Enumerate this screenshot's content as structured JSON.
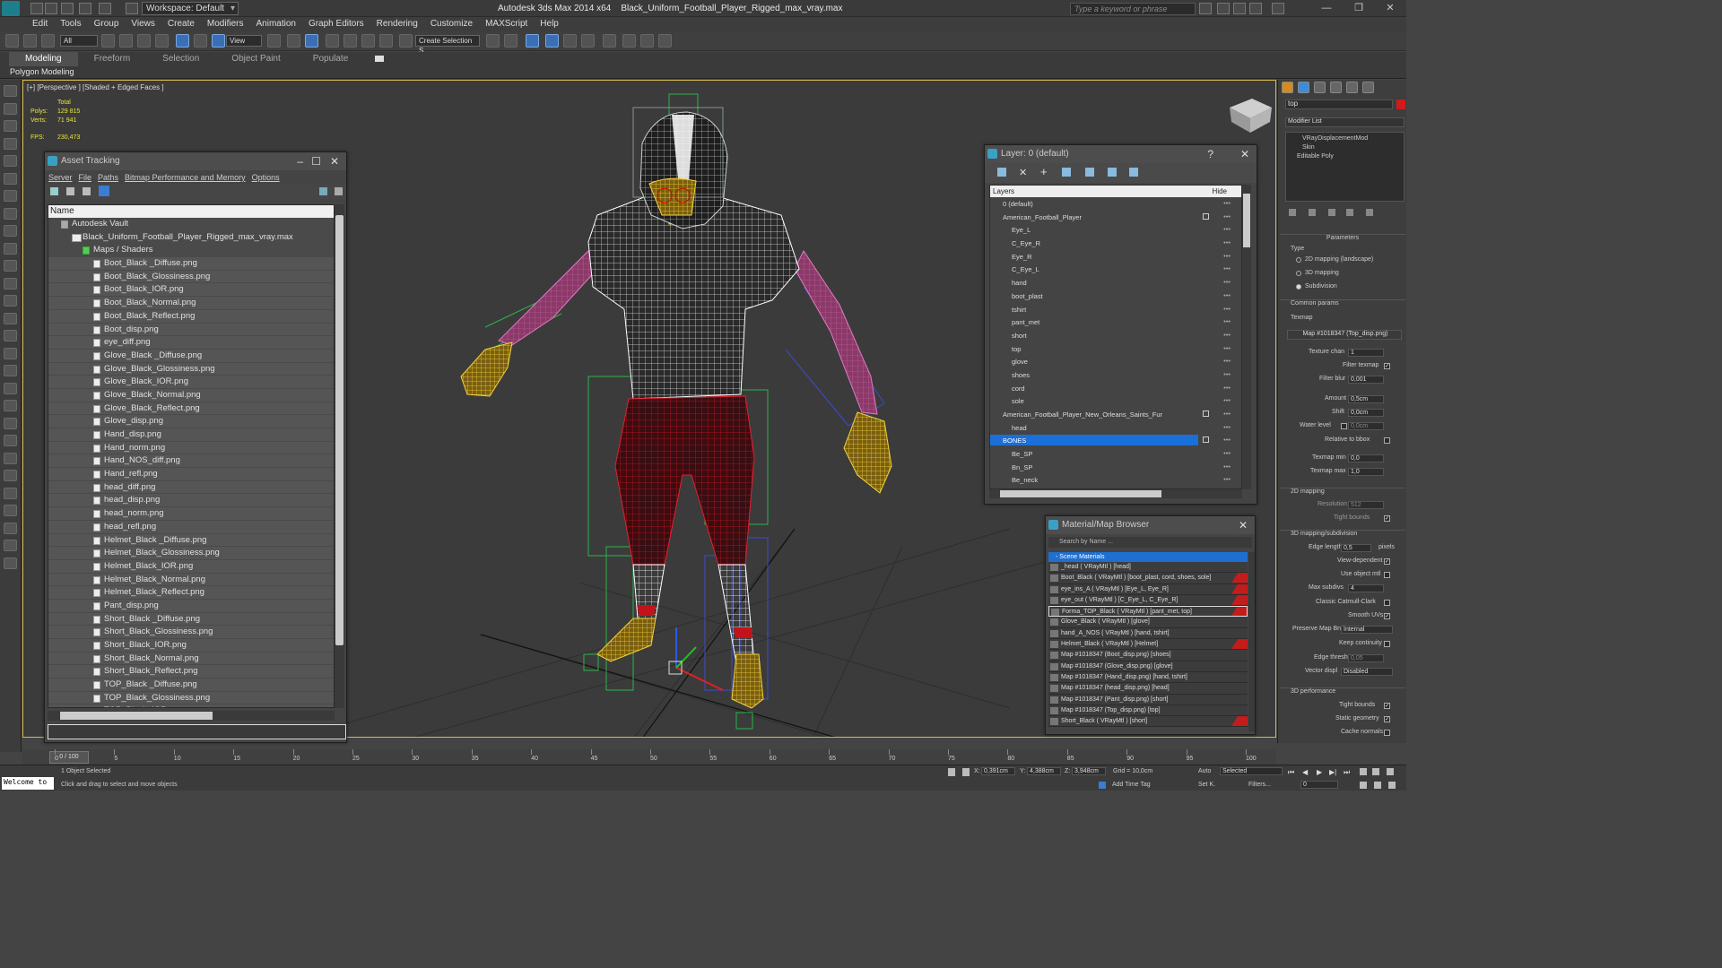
{
  "title_bar": {
    "app_title": "Autodesk 3ds Max  2014 x64",
    "file_name": "Black_Uniform_Football_Player_Rigged_max_vray.max",
    "workspace": "Workspace: Default",
    "search_placeholder": "Type a keyword or phrase"
  },
  "menu": [
    "Edit",
    "Tools",
    "Group",
    "Views",
    "Create",
    "Modifiers",
    "Animation",
    "Graph Editors",
    "Rendering",
    "Customize",
    "MAXScript",
    "Help"
  ],
  "toolbar": {
    "selection_filter": "All",
    "ref_coord": "View",
    "named_selection": "Create Selection S"
  },
  "ribbon": {
    "tabs": [
      "Modeling",
      "Freeform",
      "Selection",
      "Object Paint",
      "Populate"
    ],
    "active_tab": "Modeling",
    "sub_label": "Polygon Modeling"
  },
  "viewport": {
    "label": "[+] [Perspective ] [Shaded + Edged Faces ]",
    "stats_header": "Total",
    "polys_label": "Polys:",
    "polys_value": "129 815",
    "verts_label": "Verts:",
    "verts_value": "71 941",
    "fps_label": "FPS:",
    "fps_value": "230,473"
  },
  "asset_tracking": {
    "title": "Asset Tracking",
    "menu": [
      "Server",
      "File",
      "Paths",
      "Bitmap Performance and Memory",
      "Options"
    ],
    "column_header": "Name",
    "vault": "Autodesk Vault",
    "max_file": "Black_Uniform_Football_Player_Rigged_max_vray.max",
    "group": "Maps / Shaders",
    "files": [
      "Boot_Black _Diffuse.png",
      "Boot_Black_Glossiness.png",
      "Boot_Black_IOR.png",
      "Boot_Black_Normal.png",
      "Boot_Black_Reflect.png",
      "Boot_disp.png",
      "eye_diff.png",
      "Glove_Black _Diffuse.png",
      "Glove_Black_Glossiness.png",
      "Glove_Black_IOR.png",
      "Glove_Black_Normal.png",
      "Glove_Black_Reflect.png",
      "Glove_disp.png",
      "Hand_disp.png",
      "Hand_norm.png",
      "Hand_NOS_diff.png",
      "Hand_refl.png",
      "head_diff.png",
      "head_disp.png",
      "head_norm.png",
      "head_refl.png",
      "Helmet_Black _Diffuse.png",
      "Helmet_Black_Glossiness.png",
      "Helmet_Black_IOR.png",
      "Helmet_Black_Normal.png",
      "Helmet_Black_Reflect.png",
      "Pant_disp.png",
      "Short_Black _Diffuse.png",
      "Short_Black_Glossiness.png",
      "Short_Black_IOR.png",
      "Short_Black_Normal.png",
      "Short_Black_Reflect.png",
      "TOP_Black _Diffuse.png",
      "TOP_Black_Glossiness.png",
      "TOP_Black_IOR"
    ]
  },
  "layer_panel": {
    "title": "Layer: 0 (default)",
    "col_layers": "Layers",
    "col_hide": "Hide",
    "rows": [
      {
        "label": "0 (default)",
        "indent": 1,
        "check": false
      },
      {
        "label": "American_Football_Player",
        "indent": 1,
        "check": true
      },
      {
        "label": "Eye_L",
        "indent": 2,
        "check": false
      },
      {
        "label": "C_Eye_R",
        "indent": 2,
        "check": false
      },
      {
        "label": "Eye_R",
        "indent": 2,
        "check": false
      },
      {
        "label": "C_Eye_L",
        "indent": 2,
        "check": false
      },
      {
        "label": "hand",
        "indent": 2,
        "check": false
      },
      {
        "label": "boot_plast",
        "indent": 2,
        "check": false
      },
      {
        "label": "tshirt",
        "indent": 2,
        "check": false
      },
      {
        "label": "pant_met",
        "indent": 2,
        "check": false
      },
      {
        "label": "short",
        "indent": 2,
        "check": false
      },
      {
        "label": "top",
        "indent": 2,
        "check": false
      },
      {
        "label": "glove",
        "indent": 2,
        "check": false
      },
      {
        "label": "shoes",
        "indent": 2,
        "check": false
      },
      {
        "label": "cord",
        "indent": 2,
        "check": false
      },
      {
        "label": "sole",
        "indent": 2,
        "check": false
      },
      {
        "label": "American_Football_Player_New_Orleans_Saints_Fur",
        "indent": 1,
        "check": true
      },
      {
        "label": "head",
        "indent": 2,
        "check": false
      },
      {
        "label": "BONES",
        "indent": 1,
        "check": true,
        "selected": true
      },
      {
        "label": "Be_SP",
        "indent": 2,
        "check": false
      },
      {
        "label": "Bn_SP",
        "indent": 2,
        "check": false
      },
      {
        "label": "Be_neck",
        "indent": 2,
        "check": false
      }
    ]
  },
  "material_browser": {
    "title": "Material/Map Browser",
    "search_placeholder": "Search by Name ...",
    "group": "- Scene Materials",
    "items": [
      {
        "label": "_head  ( VRayMtl ) [head]",
        "red": false
      },
      {
        "label": "Boot_Black  ( VRayMtl ) [boot_plast, cord, shoes, sole]",
        "red": true
      },
      {
        "label": "eye_ins_A  ( VRayMtl ) [Eye_L, Eye_R]",
        "red": true
      },
      {
        "label": "eye_out  ( VRayMtl ) [C_Eye_L, C_Eye_R]",
        "red": true
      },
      {
        "label": "Forma_TOP_Black  ( VRayMtl ) [pant_met, top]",
        "red": true,
        "hl": true
      },
      {
        "label": "Glove_Black  ( VRayMtl ) [glove]",
        "red": false
      },
      {
        "label": "hand_A_NOS  ( VRayMtl ) [hand, tshirt]",
        "red": false
      },
      {
        "label": "Helmet_Black  ( VRayMtl ) [Helmet]",
        "red": true
      },
      {
        "label": "Map #1018347 (Boot_disp.png) [shoes]",
        "red": false
      },
      {
        "label": "Map #1018347 (Glove_disp.png) [glove]",
        "red": false
      },
      {
        "label": "Map #1018347 (Hand_disp.png) [hand, tshirt]",
        "red": false
      },
      {
        "label": "Map #1018347 (head_disp.png) [head]",
        "red": false
      },
      {
        "label": "Map #1018347 (Pant_disp.png) [short]",
        "red": false
      },
      {
        "label": "Map #1018347 (Top_disp.png) [top]",
        "red": false
      },
      {
        "label": "Short_Black  ( VRayMtl ) [short]",
        "red": true
      }
    ]
  },
  "command_panel": {
    "object_name": "top",
    "modifier_list": "Modifier List",
    "stack": [
      "VRayDisplacementMod",
      "Skin",
      "Editable Poly"
    ],
    "parameters": "Parameters",
    "type_label": "Type",
    "type_options": [
      "2D mapping (landscape)",
      "3D mapping",
      "Subdivision"
    ],
    "selected_type": "Subdivision",
    "common_params": "Common params",
    "texmap_label": "Texmap",
    "texmap_value": "Map #1018347 (Top_disp.png)",
    "texture_chan_label": "Texture chan",
    "texture_chan": "1",
    "filter_texmap": "Filter texmap",
    "filter_blur_label": "Filter blur",
    "filter_blur": "0,001",
    "amount_label": "Amount",
    "amount": "0,5cm",
    "shift_label": "Shift",
    "shift": "0,0cm",
    "water_label": "Water level",
    "water": "0,0cm",
    "rel_bbox": "Relative to bbox",
    "texmap_min_label": "Texmap min",
    "texmap_min": "0,0",
    "texmap_max_label": "Texmap max",
    "texmap_max": "1,0",
    "mapping_2d": "2D mapping",
    "resolution_label": "Resolution",
    "resolution": "512",
    "tight_bounds": "Tight bounds",
    "mapping_3d": "3D mapping/subdivision",
    "edge_length_label": "Edge length",
    "edge_length": "0,5",
    "edge_units": "pixels",
    "view_dependent": "View-dependent",
    "use_object_mtl": "Use object mtl",
    "max_subdivs_label": "Max subdivs",
    "max_subdivs": "4",
    "catmull": "Classic Catmull-Clark",
    "smooth_uvs": "Smooth UVs",
    "preserve_label": "Preserve Map Bnd",
    "preserve_value": "Internal",
    "keep_continuity": "Keep continuity",
    "edge_thresh_label": "Edge thresh",
    "edge_thresh": "0,05",
    "vector_disp_label": "Vector displ",
    "vector_disp_value": "Disabled",
    "performance": "3D performance",
    "tight_bounds2": "Tight bounds",
    "static_geometry": "Static geometry",
    "cache_normals": "Cache normals"
  },
  "timeline": {
    "frame_counter": "0 / 100",
    "ticks": [
      "0",
      "5",
      "10",
      "15",
      "20",
      "25",
      "30",
      "35",
      "40",
      "45",
      "50",
      "55",
      "60",
      "65",
      "70",
      "75",
      "80",
      "85",
      "90",
      "95",
      "100"
    ]
  },
  "status": {
    "welcome": "Welcome to",
    "selected": "1 Object Selected",
    "hint": "Click and drag to select and move objects",
    "x_label": "X:",
    "x": "0,391cm",
    "y_label": "Y:",
    "y": "4,388cm",
    "z_label": "Z:",
    "z": "3,948cm",
    "grid": "Grid = 10,0cm",
    "auto": "Auto",
    "set_key": "Set K.",
    "selected_dd": "Selected",
    "filters": "Filters...",
    "add_time_tag": "Add Time Tag",
    "frame": "0"
  }
}
